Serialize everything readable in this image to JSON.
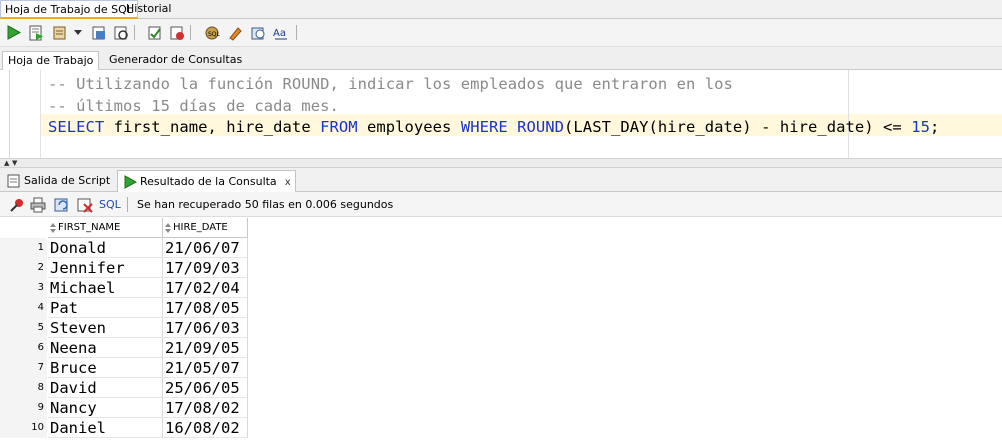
{
  "top_tabs": [
    {
      "label": "Hoja de Trabajo de SQL"
    },
    {
      "label": "Historial"
    }
  ],
  "toolbar": {
    "icons": [
      "run-statement-icon",
      "run-script-icon",
      "autotrace-icon",
      "dropdown-arrow-icon",
      "explain-plan-icon",
      "sql-tuning-icon",
      "commit-icon",
      "rollback-icon",
      "unshared-sql-icon",
      "clear-icon",
      "history-icon",
      "format-case-icon"
    ]
  },
  "sub_tabs": [
    {
      "label": "Hoja de Trabajo"
    },
    {
      "label": "Generador de Consultas"
    }
  ],
  "editor": {
    "comment_line1": "-- Utilizando la función ROUND, indicar los empleados que entraron en los",
    "comment_line2": "-- últimos 15 días de cada mes.",
    "sql_parts": {
      "select": "SELECT",
      "cols": " first_name, hire_date ",
      "from": "FROM",
      "table": " employees ",
      "where": "WHERE",
      "space": " ",
      "round": "ROUND",
      "expr": "(LAST_DAY(hire_date) - hire_date) <= ",
      "num": "15",
      "end": ";"
    }
  },
  "output_tabs": [
    {
      "label": "Salida de Script",
      "close": "x"
    },
    {
      "label": "Resultado de la Consulta",
      "close": "x"
    }
  ],
  "result_toolbar": {
    "sql_label": "SQL",
    "status": "Se han recuperado 50 filas en 0.006 segundos"
  },
  "grid": {
    "columns": [
      "FIRST_NAME",
      "HIRE_DATE"
    ],
    "rows": [
      {
        "n": "1",
        "first_name": "Donald",
        "hire_date": "21/06/07"
      },
      {
        "n": "2",
        "first_name": "Jennifer",
        "hire_date": "17/09/03"
      },
      {
        "n": "3",
        "first_name": "Michael",
        "hire_date": "17/02/04"
      },
      {
        "n": "4",
        "first_name": "Pat",
        "hire_date": "17/08/05"
      },
      {
        "n": "5",
        "first_name": "Steven",
        "hire_date": "17/06/03"
      },
      {
        "n": "6",
        "first_name": "Neena",
        "hire_date": "21/09/05"
      },
      {
        "n": "7",
        "first_name": "Bruce",
        "hire_date": "21/05/07"
      },
      {
        "n": "8",
        "first_name": "David",
        "hire_date": "25/06/05"
      },
      {
        "n": "9",
        "first_name": "Nancy",
        "hire_date": "17/08/02"
      },
      {
        "n": "10",
        "first_name": "Daniel",
        "hire_date": "16/08/02"
      }
    ]
  },
  "colors": {
    "keyword": "#1a33c9",
    "comment": "#8a8a8a",
    "current_line": "#fff8dc",
    "tab_accent": "#f5a623"
  }
}
